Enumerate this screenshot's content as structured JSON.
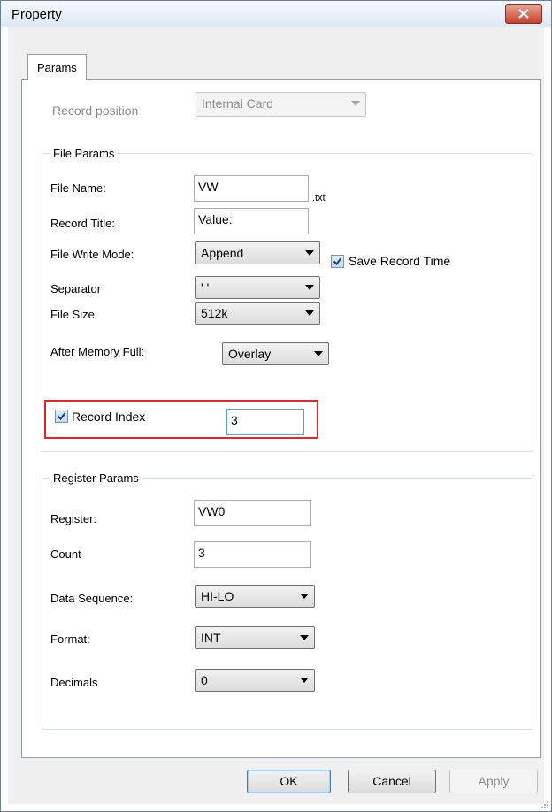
{
  "window": {
    "title": "Property"
  },
  "tabs": [
    {
      "label": "Params"
    }
  ],
  "record_position": {
    "label": "Record position",
    "value": "Internal Card"
  },
  "file_params": {
    "group_label": "File Params",
    "file_name": {
      "label": "File Name:",
      "value": "VW",
      "extension": ".txt"
    },
    "record_title": {
      "label": "Record Title:",
      "value": "Value:"
    },
    "file_write_mode": {
      "label": "File Write Mode:",
      "value": "Append"
    },
    "save_record_time": {
      "label": "Save Record Time",
      "checked": true
    },
    "separator": {
      "label": "Separator",
      "value": "' '"
    },
    "file_size": {
      "label": "File Size",
      "value": "512k"
    },
    "after_memory_full": {
      "label": "After Memory Full:",
      "value": "Overlay"
    },
    "record_index": {
      "label": "Record Index",
      "checked": true,
      "value": "3"
    }
  },
  "register_params": {
    "group_label": "Register Params",
    "register": {
      "label": "Register:",
      "value": "VW0"
    },
    "count": {
      "label": "Count",
      "value": "3"
    },
    "data_sequence": {
      "label": "Data Sequence:",
      "value": "HI-LO"
    },
    "format": {
      "label": "Format:",
      "value": "INT"
    },
    "decimals": {
      "label": "Decimals",
      "value": "0"
    }
  },
  "buttons": {
    "ok": "OK",
    "cancel": "Cancel",
    "apply": "Apply"
  },
  "colors": {
    "highlight_border": "#e8232a",
    "close_button": "#c7432a"
  }
}
